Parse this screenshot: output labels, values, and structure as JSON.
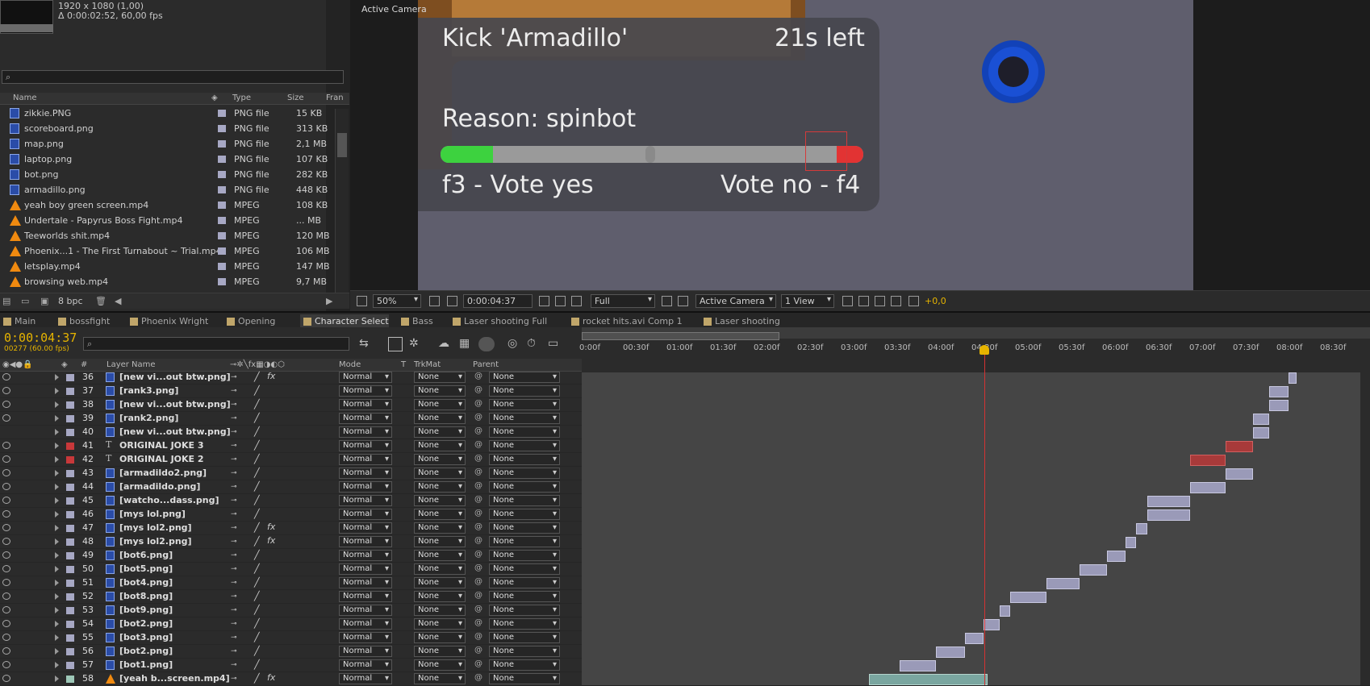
{
  "project": {
    "meta_line1": "1920 x 1080 (1,00)",
    "meta_line2": "Δ 0:00:02:52, 60,00 fps",
    "search_placeholder": "",
    "columns": {
      "name": "Name",
      "type": "Type",
      "size": "Size",
      "frame": "Fran"
    },
    "files": [
      {
        "name": "zikkie.PNG",
        "type": "PNG file",
        "size": "15 KB",
        "icon": "png-file-icon"
      },
      {
        "name": "scoreboard.png",
        "type": "PNG file",
        "size": "313 KB",
        "icon": "png-file-icon"
      },
      {
        "name": "map.png",
        "type": "PNG file",
        "size": "2,1 MB",
        "icon": "png-file-icon"
      },
      {
        "name": "laptop.png",
        "type": "PNG file",
        "size": "107 KB",
        "icon": "png-file-icon"
      },
      {
        "name": "bot.png",
        "type": "PNG file",
        "size": "282 KB",
        "icon": "png-file-icon"
      },
      {
        "name": "armadillo.png",
        "type": "PNG file",
        "size": "448 KB",
        "icon": "png-file-icon"
      },
      {
        "name": "yeah boy green screen.mp4",
        "type": "MPEG",
        "size": "108 KB",
        "icon": "vlc-cone-icon"
      },
      {
        "name": "Undertale - Papyrus Boss Fight.mp4",
        "type": "MPEG",
        "size": "... MB",
        "icon": "vlc-cone-icon"
      },
      {
        "name": "Teeworlds shit.mp4",
        "type": "MPEG",
        "size": "120 MB",
        "icon": "vlc-cone-icon"
      },
      {
        "name": "Phoenix...1 - The First Turnabout ~ Trial.mp4",
        "type": "MPEG",
        "size": "106 MB",
        "icon": "vlc-cone-icon"
      },
      {
        "name": "letsplay.mp4",
        "type": "MPEG",
        "size": "147 MB",
        "icon": "vlc-cone-icon"
      },
      {
        "name": "browsing web.mp4",
        "type": "MPEG",
        "size": "9,7 MB",
        "icon": "vlc-cone-icon"
      }
    ],
    "bpc": "8 bpc"
  },
  "viewer": {
    "label": "Active Camera",
    "kick_title": "Kick 'Armadillo'",
    "time_left": "21s left",
    "reason": "Reason: spinbot",
    "vote_yes": "f3 - Vote yes",
    "vote_no": "Vote no - f4",
    "zoom": "50%",
    "timecode": "0:00:04:37",
    "resolution": "Full",
    "camera": "Active Camera",
    "views": "1 View",
    "exposure": "+0,0"
  },
  "tabs": [
    "Main",
    "bossfight",
    "Phoenix Wright",
    "Opening",
    "Character Select",
    "Bass",
    "Laser shooting Full",
    "rocket hits.avi Comp 1",
    "Laser shooting"
  ],
  "active_tab": "Character Select",
  "timeline": {
    "timecode": "0:00:04:37",
    "frames": "00277 (60.00 fps)",
    "columns": {
      "num": "#",
      "layer": "Layer Name",
      "mode": "Mode",
      "t": "T",
      "trkmat": "TrkMat",
      "parent": "Parent"
    },
    "ruler": [
      "0:00f",
      "00:30f",
      "01:00f",
      "01:30f",
      "02:00f",
      "02:30f",
      "03:00f",
      "03:30f",
      "04:00f",
      "04:30f",
      "05:00f",
      "05:30f",
      "06:00f",
      "06:30f",
      "07:00f",
      "07:30f",
      "08:00f",
      "08:30f"
    ],
    "layers": [
      {
        "num": "36",
        "name": "[new vi...out btw.png]",
        "type": "png",
        "color": "#a7a8c4",
        "fx": true
      },
      {
        "num": "37",
        "name": "[rank3.png]",
        "type": "png",
        "color": "#a7a8c4",
        "fx": false
      },
      {
        "num": "38",
        "name": "[new vi...out btw.png]",
        "type": "png",
        "color": "#a7a8c4",
        "fx": false
      },
      {
        "num": "39",
        "name": "[rank2.png]",
        "type": "png",
        "color": "#a7a8c4",
        "fx": false
      },
      {
        "num": "40",
        "name": "[new vi...out btw.png]",
        "type": "png",
        "color": "#a7a8c4",
        "fx": false
      },
      {
        "num": "41",
        "name": "ORIGINAL JOKE 3",
        "type": "text",
        "color": "#c8383a",
        "fx": false
      },
      {
        "num": "42",
        "name": "ORIGINAL JOKE 2",
        "type": "text",
        "color": "#c8383a",
        "fx": false
      },
      {
        "num": "43",
        "name": "[armadildo2.png]",
        "type": "png",
        "color": "#a7a8c4",
        "fx": false
      },
      {
        "num": "44",
        "name": "[armadildo.png]",
        "type": "png",
        "color": "#a7a8c4",
        "fx": false
      },
      {
        "num": "45",
        "name": "[watcho...dass.png]",
        "type": "png",
        "color": "#a7a8c4",
        "fx": false
      },
      {
        "num": "46",
        "name": "[mys lol.png]",
        "type": "png",
        "color": "#a7a8c4",
        "fx": false
      },
      {
        "num": "47",
        "name": "[mys lol2.png]",
        "type": "png",
        "color": "#a7a8c4",
        "fx": true
      },
      {
        "num": "48",
        "name": "[mys lol2.png]",
        "type": "png",
        "color": "#a7a8c4",
        "fx": true
      },
      {
        "num": "49",
        "name": "[bot6.png]",
        "type": "png",
        "color": "#a7a8c4",
        "fx": false
      },
      {
        "num": "50",
        "name": "[bot5.png]",
        "type": "png",
        "color": "#a7a8c4",
        "fx": false
      },
      {
        "num": "51",
        "name": "[bot4.png]",
        "type": "png",
        "color": "#a7a8c4",
        "fx": false
      },
      {
        "num": "52",
        "name": "[bot8.png]",
        "type": "png",
        "color": "#a7a8c4",
        "fx": false
      },
      {
        "num": "53",
        "name": "[bot9.png]",
        "type": "png",
        "color": "#a7a8c4",
        "fx": false
      },
      {
        "num": "54",
        "name": "[bot2.png]",
        "type": "png",
        "color": "#a7a8c4",
        "fx": false
      },
      {
        "num": "55",
        "name": "[bot3.png]",
        "type": "png",
        "color": "#a7a8c4",
        "fx": false
      },
      {
        "num": "56",
        "name": "[bot2.png]",
        "type": "png",
        "color": "#a7a8c4",
        "fx": false
      },
      {
        "num": "57",
        "name": "[bot1.png]",
        "type": "png",
        "color": "#a7a8c4",
        "fx": false
      },
      {
        "num": "58",
        "name": "[yeah b...screen.mp4]",
        "type": "video",
        "color": "#9ec8b8",
        "fx": true
      }
    ],
    "mode_value": "Normal",
    "trkmat_value": "None",
    "parent_value": "None"
  }
}
